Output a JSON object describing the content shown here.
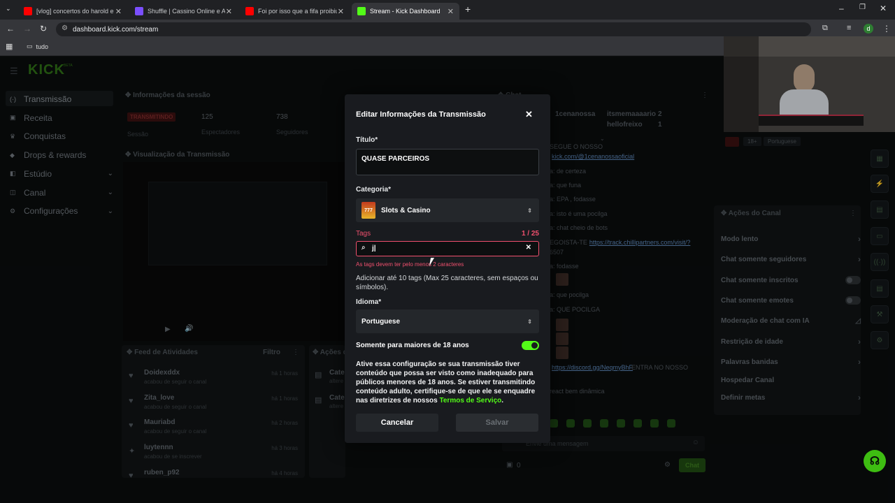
{
  "browser": {
    "tabs": [
      {
        "title": "[vlog] concertos do harold e cl",
        "color": "#ff0000"
      },
      {
        "title": "Shuffle | Cassino Online e Apo",
        "color": "#7b4fff"
      },
      {
        "title": "Foi por isso que a fifa proibiu a",
        "color": "#ff0000"
      },
      {
        "title": "Stream - Kick Dashboard",
        "color": "#53fc18"
      }
    ],
    "url": "dashboard.kick.com/stream",
    "bookmark": "tudo",
    "profile_initial": "d"
  },
  "sidebar": {
    "logo": "KICK",
    "logo_badge": "BETA",
    "items": [
      {
        "label": "Transmissão",
        "icon": "(·)"
      },
      {
        "label": "Receita",
        "icon": "▣"
      },
      {
        "label": "Conquistas",
        "icon": "♛"
      },
      {
        "label": "Drops & rewards",
        "icon": "◆"
      },
      {
        "label": "Estúdio",
        "icon": "◧"
      },
      {
        "label": "Canal",
        "icon": "◫"
      },
      {
        "label": "Configurações",
        "icon": "⚙"
      }
    ]
  },
  "session": {
    "title": "Informações da sessão",
    "status": "TRANSMITINDO",
    "status_label": "Sessão",
    "viewers": "125",
    "viewers_label": "Espectadores",
    "followers": "738",
    "followers_label": "Seguidores"
  },
  "preview": {
    "title": "Visualização da Transmissão"
  },
  "feed": {
    "title": "Feed de Atividades",
    "filter": "Filtro",
    "items": [
      {
        "name": "Doidexddx",
        "sub": "acabou de seguir o canal",
        "time": "há 1 horas",
        "icon": "♥"
      },
      {
        "name": "Zita_love",
        "sub": "acabou de seguir o canal",
        "time": "há 1 horas",
        "icon": "♥"
      },
      {
        "name": "Mauriabd",
        "sub": "acabou de seguir o canal",
        "time": "há 2 horas",
        "icon": "♥"
      },
      {
        "name": "luytennn",
        "sub": "acabou de se inscrever",
        "time": "há 3 horas",
        "icon": "✦"
      },
      {
        "name": "ruben_p92",
        "sub": "",
        "time": "há 4 horas",
        "icon": "♥"
      }
    ]
  },
  "actions_partial": {
    "title": "Ações d",
    "items": [
      {
        "label": "Cate",
        "sub": "altere"
      },
      {
        "label": "Cate",
        "sub": "altere"
      }
    ]
  },
  "chat": {
    "title": "Chat",
    "leaderboard": [
      {
        "name": "1cenanossa",
        "count": ""
      },
      {
        "name": "itsmemaaaario",
        "count": "2"
      },
      {
        "name": "hellofreixo",
        "count": "1"
      }
    ],
    "lines": [
      {
        "prefix": "SEGUE O NOSSO",
        "link": ""
      },
      {
        "prefix": "",
        "link": "kick.com/@1cenanossaoficial"
      },
      {
        "prefix": "a: de certeza",
        "link": ""
      },
      {
        "prefix": "a: que funa",
        "link": ""
      },
      {
        "prefix": "a: EPA , fodasse",
        "link": ""
      },
      {
        "prefix": "a: isto é uma pocilga",
        "link": ""
      },
      {
        "prefix": "a: chat cheio de bots",
        "link": ""
      },
      {
        "prefix": "EGOISTA-TE",
        "link": "https://track.chillipartners.com/visit/?"
      },
      {
        "prefix": "6507",
        "link": ""
      },
      {
        "prefix": "a: fodasse",
        "link": ""
      },
      {
        "prefix": "a: que pocilga",
        "link": ""
      },
      {
        "prefix": "a: QUE POCILGA",
        "link": ""
      },
      {
        "prefix": "",
        "link": "https://discord.gg/NeqmyBhF"
      },
      {
        "prefix": "react bem dinâmica",
        "link": ""
      }
    ],
    "discord_suffix": "ENTRA NO NOSSO",
    "input_placeholder": "Envie uma mensagem",
    "points": "0",
    "send": "Chat"
  },
  "channel_panel": {
    "badge_age": "18+",
    "language": "Portuguese",
    "title": "Ações do Canal",
    "items": [
      {
        "label": "Modo lento",
        "control": "chevron"
      },
      {
        "label": "Chat somente seguidores",
        "control": "chevron"
      },
      {
        "label": "Chat somente inscritos",
        "control": "toggle"
      },
      {
        "label": "Chat somente emotes",
        "control": "toggle"
      },
      {
        "label": "Moderação de chat com IA",
        "control": "icon"
      },
      {
        "label": "Restrição de idade",
        "control": "chevron"
      },
      {
        "label": "Palavras banidas",
        "control": "chevron"
      },
      {
        "label": "Hospedar Canal",
        "control": "none"
      },
      {
        "label": "Definir metas",
        "control": "chevron"
      }
    ]
  },
  "modal": {
    "title": "Editar Informações da Transmissão",
    "title_label": "Título*",
    "title_value": "QUASE PARCEIROS",
    "category_label": "Categoria*",
    "category_value": "Slots & Casino",
    "tags_label": "Tags",
    "tags_count": "1 / 25",
    "tags_value": "j",
    "tags_error": "As tags devem ter pelo menos 2 caracteres",
    "tags_help": "Adicionar até 10 tags (Max 25 caracteres, sem espaços ou símbolos).",
    "language_label": "Idioma*",
    "language_value": "Portuguese",
    "mature_label": "Somente para maiores de 18 anos",
    "mature_on": true,
    "mature_desc": "Ative essa configuração se sua transmissão tiver conteúdo que possa ser visto como inadequado para públicos menores de 18 anos. Se estiver transmitindo conteúdo adulto, certifique-se de que ele se enquadre nas diretrizes de nossos",
    "terms_link": "Termos de Serviço",
    "cancel": "Cancelar",
    "save": "Salvar"
  },
  "colors": {
    "accent": "#53fc18",
    "error": "#f0506e",
    "modal_bg": "#191b1f"
  }
}
